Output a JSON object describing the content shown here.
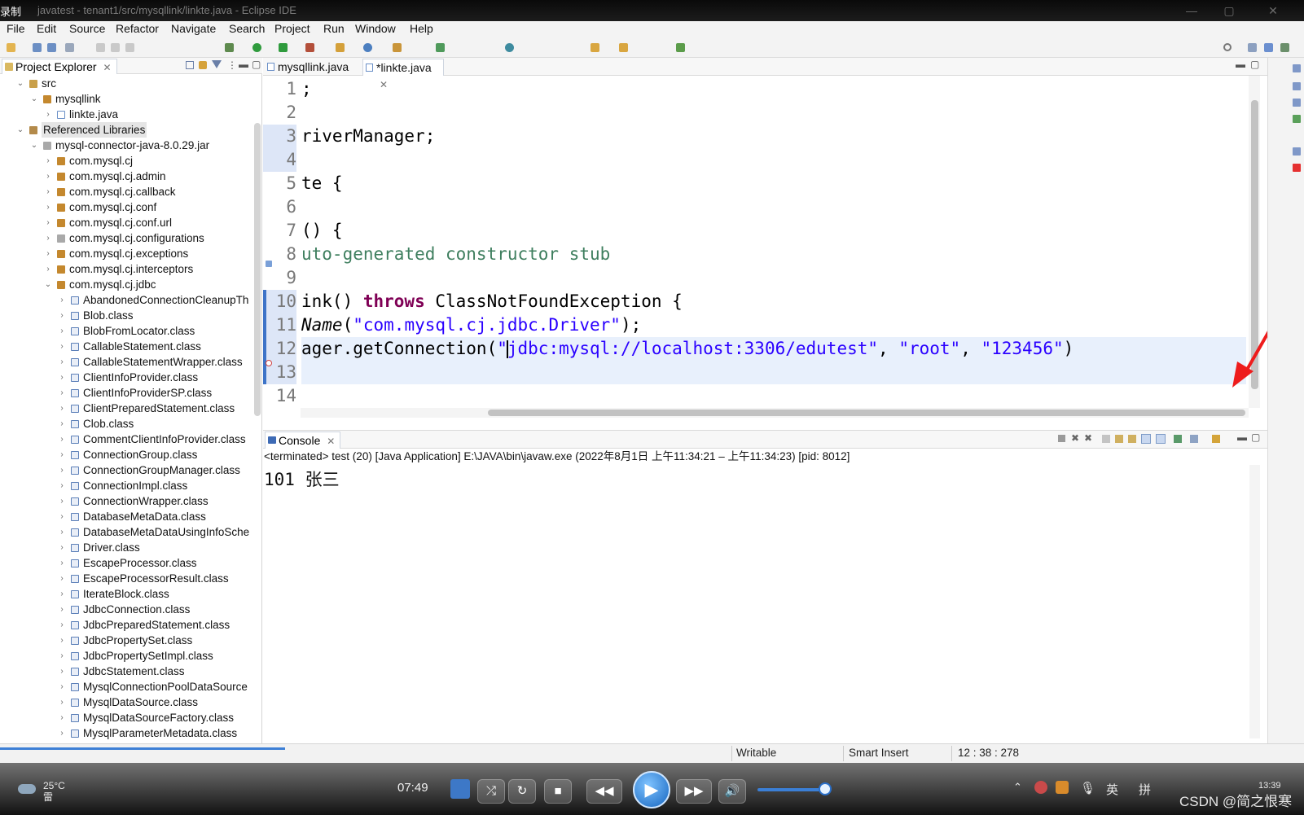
{
  "window": {
    "recording_label": "录制",
    "title": "javatest - tenant1/src/mysqllink/linkte.java - Eclipse IDE",
    "controls": [
      "—",
      "▢",
      "✕"
    ]
  },
  "menu": [
    "File",
    "Edit",
    "Source",
    "Refactor",
    "Navigate",
    "Search",
    "Project",
    "Run",
    "Window",
    "Help"
  ],
  "project_explorer": {
    "tab_label": "Project Explorer",
    "tree": [
      {
        "label": "src",
        "twist": "⌄",
        "icon": "src"
      },
      {
        "label": "mysqllink",
        "twist": "⌄",
        "icon": "pkg"
      },
      {
        "label": "linkte.java",
        "twist": "›",
        "icon": "java"
      },
      {
        "label": "Referenced Libraries",
        "twist": "⌄",
        "icon": "lib",
        "selected": true
      },
      {
        "label": "mysql-connector-java-8.0.29.jar",
        "twist": "⌄",
        "icon": "jar"
      },
      {
        "label": "com.mysql.cj",
        "twist": "›",
        "icon": "pkg"
      },
      {
        "label": "com.mysql.cj.admin",
        "twist": "›",
        "icon": "pkg"
      },
      {
        "label": "com.mysql.cj.callback",
        "twist": "›",
        "icon": "pkg"
      },
      {
        "label": "com.mysql.cj.conf",
        "twist": "›",
        "icon": "pkg"
      },
      {
        "label": "com.mysql.cj.conf.url",
        "twist": "›",
        "icon": "pkg"
      },
      {
        "label": "com.mysql.cj.configurations",
        "twist": "›",
        "icon": "jar"
      },
      {
        "label": "com.mysql.cj.exceptions",
        "twist": "›",
        "icon": "pkg"
      },
      {
        "label": "com.mysql.cj.interceptors",
        "twist": "›",
        "icon": "pkg"
      },
      {
        "label": "com.mysql.cj.jdbc",
        "twist": "⌄",
        "icon": "pkg"
      },
      {
        "label": "AbandonedConnectionCleanupTh",
        "twist": "›",
        "icon": "cls"
      },
      {
        "label": "Blob.class",
        "twist": "›",
        "icon": "cls"
      },
      {
        "label": "BlobFromLocator.class",
        "twist": "›",
        "icon": "cls"
      },
      {
        "label": "CallableStatement.class",
        "twist": "›",
        "icon": "cls"
      },
      {
        "label": "CallableStatementWrapper.class",
        "twist": "›",
        "icon": "cls"
      },
      {
        "label": "ClientInfoProvider.class",
        "twist": "›",
        "icon": "cls"
      },
      {
        "label": "ClientInfoProviderSP.class",
        "twist": "›",
        "icon": "cls"
      },
      {
        "label": "ClientPreparedStatement.class",
        "twist": "›",
        "icon": "cls"
      },
      {
        "label": "Clob.class",
        "twist": "›",
        "icon": "cls"
      },
      {
        "label": "CommentClientInfoProvider.class",
        "twist": "›",
        "icon": "cls"
      },
      {
        "label": "ConnectionGroup.class",
        "twist": "›",
        "icon": "cls"
      },
      {
        "label": "ConnectionGroupManager.class",
        "twist": "›",
        "icon": "cls"
      },
      {
        "label": "ConnectionImpl.class",
        "twist": "›",
        "icon": "cls"
      },
      {
        "label": "ConnectionWrapper.class",
        "twist": "›",
        "icon": "cls"
      },
      {
        "label": "DatabaseMetaData.class",
        "twist": "›",
        "icon": "cls"
      },
      {
        "label": "DatabaseMetaDataUsingInfoSche",
        "twist": "›",
        "icon": "cls"
      },
      {
        "label": "Driver.class",
        "twist": "›",
        "icon": "cls"
      },
      {
        "label": "EscapeProcessor.class",
        "twist": "›",
        "icon": "cls"
      },
      {
        "label": "EscapeProcessorResult.class",
        "twist": "›",
        "icon": "cls"
      },
      {
        "label": "IterateBlock.class",
        "twist": "›",
        "icon": "cls"
      },
      {
        "label": "JdbcConnection.class",
        "twist": "›",
        "icon": "cls"
      },
      {
        "label": "JdbcPreparedStatement.class",
        "twist": "›",
        "icon": "cls"
      },
      {
        "label": "JdbcPropertySet.class",
        "twist": "›",
        "icon": "cls"
      },
      {
        "label": "JdbcPropertySetImpl.class",
        "twist": "›",
        "icon": "cls"
      },
      {
        "label": "JdbcStatement.class",
        "twist": "›",
        "icon": "cls"
      },
      {
        "label": "MysqlConnectionPoolDataSource",
        "twist": "›",
        "icon": "cls"
      },
      {
        "label": "MysqlDataSource.class",
        "twist": "›",
        "icon": "cls"
      },
      {
        "label": "MysqlDataSourceFactory.class",
        "twist": "›",
        "icon": "cls"
      },
      {
        "label": "MysqlParameterMetadata.class",
        "twist": "›",
        "icon": "cls"
      }
    ]
  },
  "editor": {
    "tabs": [
      {
        "label": "mysqllink.java",
        "active": false
      },
      {
        "label": "*linkte.java",
        "active": true
      }
    ],
    "line_numbers": [
      "1",
      "2",
      "3",
      "4",
      "5",
      "6",
      "7",
      "8",
      "9",
      "10",
      "11",
      "12",
      "13",
      "14"
    ],
    "lines": {
      "l1": ";",
      "l3": "riverManager;",
      "l5": "te {",
      "l7": "() {",
      "l8": "uto-generated constructor stub",
      "l10_a": "ink() ",
      "l10_kw": "throws",
      "l10_b": " ClassNotFoundException {",
      "l11_a": "Name",
      "l11_b": "(",
      "l11_str": "\"com.mysql.cj.jdbc.Driver\"",
      "l11_c": ");",
      "l12_a": "ager.getConnection(",
      "l12_q": "\"",
      "l12_url": "jdbc:mysql://localhost:3306/edutest\"",
      "l12_sep1": ", ",
      "l12_user": "\"root\"",
      "l12_sep2": ", ",
      "l12_pwd": "\"123456\"",
      "l12_end": ")"
    }
  },
  "console": {
    "tab_label": "Console",
    "status": "<terminated> test (20) [Java Application] E:\\JAVA\\bin\\javaw.exe  (2022年8月1日 上午11:34:21 – 上午11:34:23) [pid: 8012]",
    "output": "101 张三"
  },
  "statusbar": {
    "writable": "Writable",
    "insert_mode": "Smart Insert",
    "position": "12 : 38 : 278"
  },
  "player": {
    "elapsed": "07:49",
    "weather_temp": "25°C",
    "weather_desc": "雷",
    "tray_lang1": "英",
    "tray_lang2": "拼",
    "clock": "13:39"
  },
  "watermark": "CSDN @简之恨寒",
  "colors": {
    "keyword": "#7f0055",
    "string": "#2a00ff",
    "comment": "#3f7f5f",
    "annotation_arrow": "#ee1c1c"
  }
}
